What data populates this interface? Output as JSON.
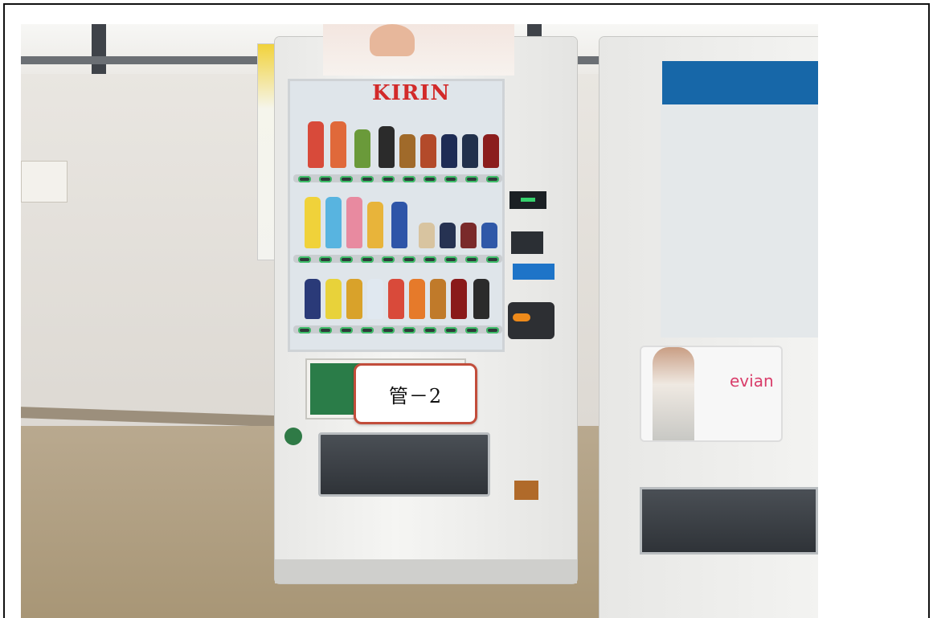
{
  "photo": {
    "callout_label": "管－2",
    "brand_text": "KIRIN",
    "vm2_ad_logo": "evian"
  }
}
